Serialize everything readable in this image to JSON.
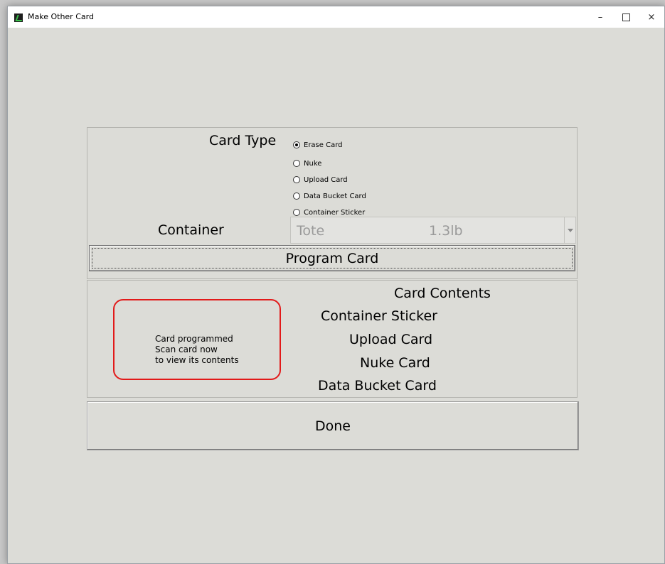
{
  "window": {
    "title": "Make Other Card",
    "minimize_symbol": "–",
    "close_symbol": "×"
  },
  "card_type": {
    "label": "Card Type",
    "options": [
      {
        "label": "Erase Card",
        "selected": true
      },
      {
        "label": "Nuke",
        "selected": false
      },
      {
        "label": "Upload Card",
        "selected": false
      },
      {
        "label": "Data Bucket Card",
        "selected": false
      },
      {
        "label": "Container Sticker",
        "selected": false
      }
    ]
  },
  "container": {
    "label": "Container",
    "selected_name": "Tote",
    "selected_weight": "1.3lb"
  },
  "program_button": {
    "label": "Program Card"
  },
  "card_contents": {
    "title": "Card Contents",
    "lines": [
      "Container Sticker",
      "Upload Card",
      "Nuke Card",
      "Data Bucket Card"
    ]
  },
  "message": {
    "lines": [
      "Card programmed",
      "Scan card now",
      "to view its contents"
    ],
    "highlight_color": "#e21a1a"
  },
  "done_button": {
    "label": "Done"
  }
}
